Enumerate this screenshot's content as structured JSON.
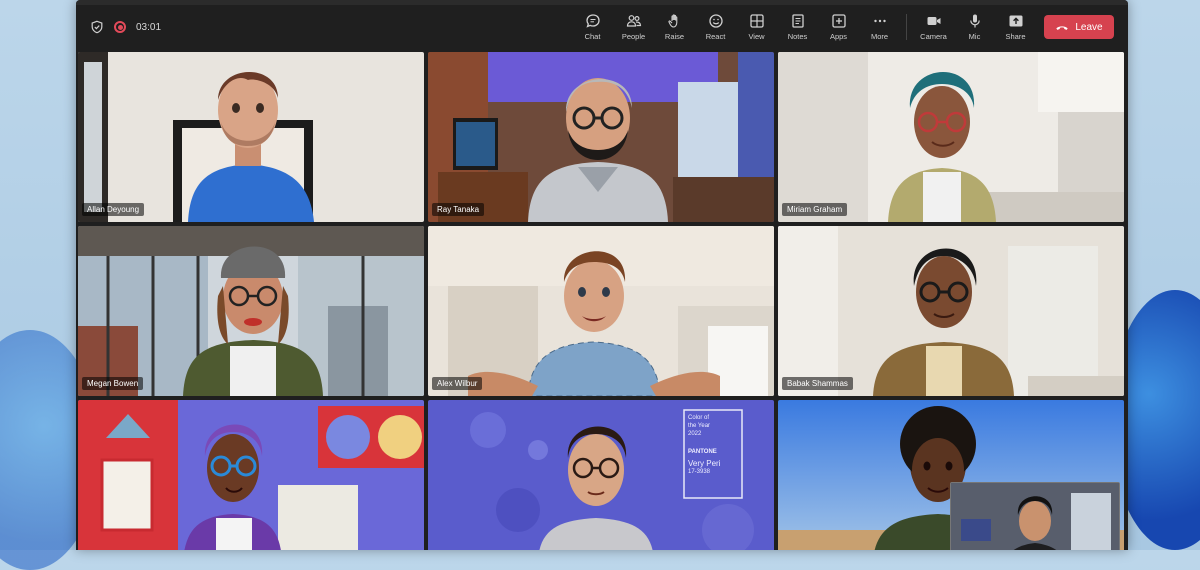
{
  "meeting": {
    "timer": "03:01"
  },
  "toolbar": {
    "buttons": [
      {
        "label": "Chat",
        "icon": "chat-icon"
      },
      {
        "label": "People",
        "icon": "people-icon"
      },
      {
        "label": "Raise",
        "icon": "raise-hand-icon"
      },
      {
        "label": "React",
        "icon": "smiley-icon"
      },
      {
        "label": "View",
        "icon": "grid-view-icon"
      },
      {
        "label": "Notes",
        "icon": "notes-icon"
      },
      {
        "label": "Apps",
        "icon": "apps-icon"
      },
      {
        "label": "More",
        "icon": "more-icon"
      },
      {
        "label": "Camera",
        "icon": "camera-icon"
      },
      {
        "label": "Mic",
        "icon": "mic-icon"
      },
      {
        "label": "Share",
        "icon": "share-icon"
      }
    ],
    "leave_label": "Leave",
    "leave_color": "#d6424f"
  },
  "participants": [
    {
      "name": "Allan Deyoung"
    },
    {
      "name": "Ray Tanaka"
    },
    {
      "name": "Miriam Graham"
    },
    {
      "name": "Megan Bowen"
    },
    {
      "name": "Alex Wilbur"
    },
    {
      "name": "Babak Shammas"
    },
    {
      "name": ""
    },
    {
      "name": ""
    },
    {
      "name": ""
    }
  ],
  "poster": {
    "line1": "Color of",
    "line2": "the Year",
    "line3": "2022",
    "brand": "PANTONE",
    "color_name": "Very Peri",
    "code": "17-3938"
  },
  "colors": {
    "accent": "#7b83eb",
    "toolbar_bg": "#1f1f1f"
  }
}
